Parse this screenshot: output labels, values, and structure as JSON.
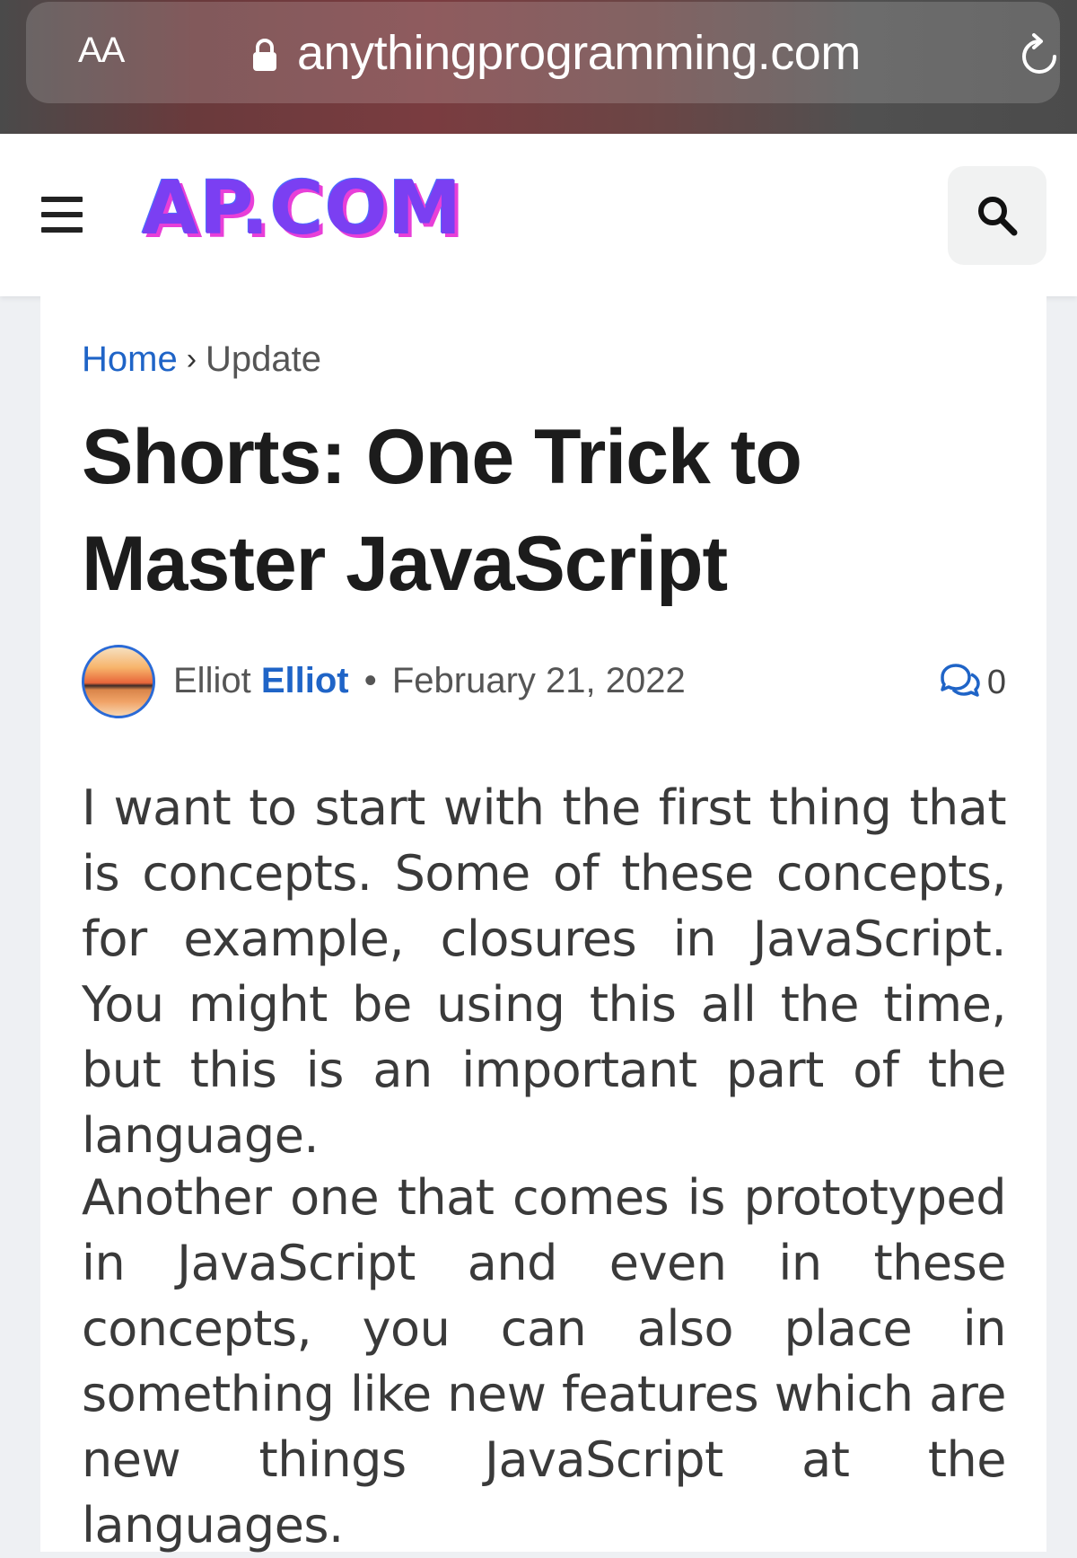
{
  "browser": {
    "aa_label": "AA",
    "url": "anythingprogramming.com"
  },
  "header": {
    "logo_text": "AP.COM",
    "search_icon": "search-icon",
    "menu_icon": "hamburger-menu-icon"
  },
  "breadcrumb": {
    "home": "Home",
    "separator": "›",
    "current": "Update"
  },
  "article": {
    "title": "Shorts: One Trick to Master JavaScript",
    "author_first": "Elliot",
    "author_link": "Elliot",
    "date_separator": "•",
    "date": "February 21, 2022",
    "comment_count": "0",
    "paragraphs": [
      " I want to start with the first thing that is concepts. Some of these concepts, for example, closures in JavaScript. You might be using this all the time, but this is an important part of the language.",
      " Another one that comes is prototyped in JavaScript and even in these concepts, you can also place in something like new features which are new things JavaScript at the languages."
    ]
  },
  "colors": {
    "link": "#1f64c7",
    "logo_primary": "#7b3ff2",
    "logo_shadow": "#e83fd8"
  }
}
